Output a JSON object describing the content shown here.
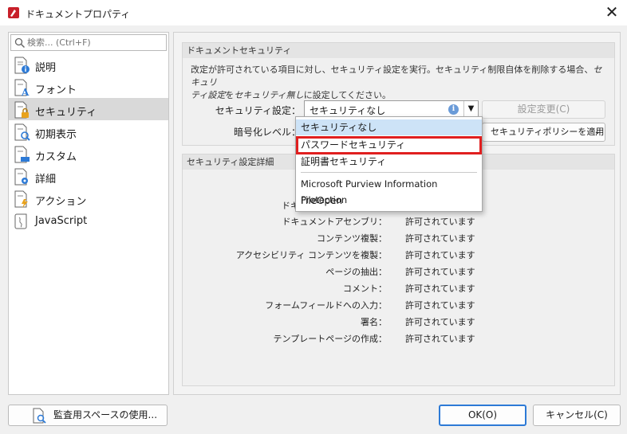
{
  "window": {
    "title": "ドキュメントプロパティ",
    "close_glyph": "✕"
  },
  "sidebar": {
    "search_placeholder": "検索... (Ctrl+F)",
    "items": [
      {
        "label": "説明",
        "icon": "document-info-icon"
      },
      {
        "label": "フォント",
        "icon": "document-font-icon"
      },
      {
        "label": "セキュリティ",
        "icon": "document-lock-icon",
        "selected": true
      },
      {
        "label": "初期表示",
        "icon": "document-view-icon"
      },
      {
        "label": "カスタム",
        "icon": "document-custom-icon"
      },
      {
        "label": "詳細",
        "icon": "document-gear-icon"
      },
      {
        "label": "アクション",
        "icon": "document-action-icon"
      },
      {
        "label": "JavaScript",
        "icon": "script-scroll-icon"
      }
    ]
  },
  "security": {
    "group_title": "ドキュメントセキュリティ",
    "desc_line1": "改定が許可されている項目に対し、セキュリティ設定を実行。セキュリティ制限自体を削除する場合、",
    "desc_italic1": "セキュリ",
    "desc_italic2": "ティ設定",
    "desc_mid": "を",
    "desc_italic3": "セキュリティ無し",
    "desc_end": "に設定してください。",
    "setting_label": "セキュリティ設定：",
    "setting_value": "セキュリティなし",
    "change_button": "設定変更(C)",
    "encryption_label": "暗号化レベル：",
    "policy_button": "セキュリティポリシーを適用"
  },
  "dropdown": {
    "options": [
      "セキュリティなし",
      "パスワードセキュリティ",
      "証明書セキュリティ",
      "Microsoft Purview Information Protection",
      "FileOpen"
    ]
  },
  "details": {
    "group_title": "セキュリティ設定詳細",
    "partial_key": "ドキ",
    "rows": [
      {
        "key": "ドキュメントアセンブリ：",
        "value": "許可されています"
      },
      {
        "key": "コンテンツ複製：",
        "value": "許可されています"
      },
      {
        "key": "アクセシビリティ コンテンツを複製：",
        "value": "許可されています"
      },
      {
        "key": "ページの抽出：",
        "value": "許可されています"
      },
      {
        "key": "コメント：",
        "value": "許可されています"
      },
      {
        "key": "フォームフィールドへの入力：",
        "value": "許可されています"
      },
      {
        "key": "署名：",
        "value": "許可されています"
      },
      {
        "key": "テンプレートページの作成：",
        "value": "許可されています"
      }
    ]
  },
  "footer": {
    "audit_button": "監査用スペースの使用...",
    "ok_button": "OK(O)",
    "cancel_button": "キャンセル(C)"
  },
  "colors": {
    "highlight_border": "#e01f1f",
    "hover_bg": "#cde3f7",
    "selected_nav_bg": "#d9d9d9"
  }
}
